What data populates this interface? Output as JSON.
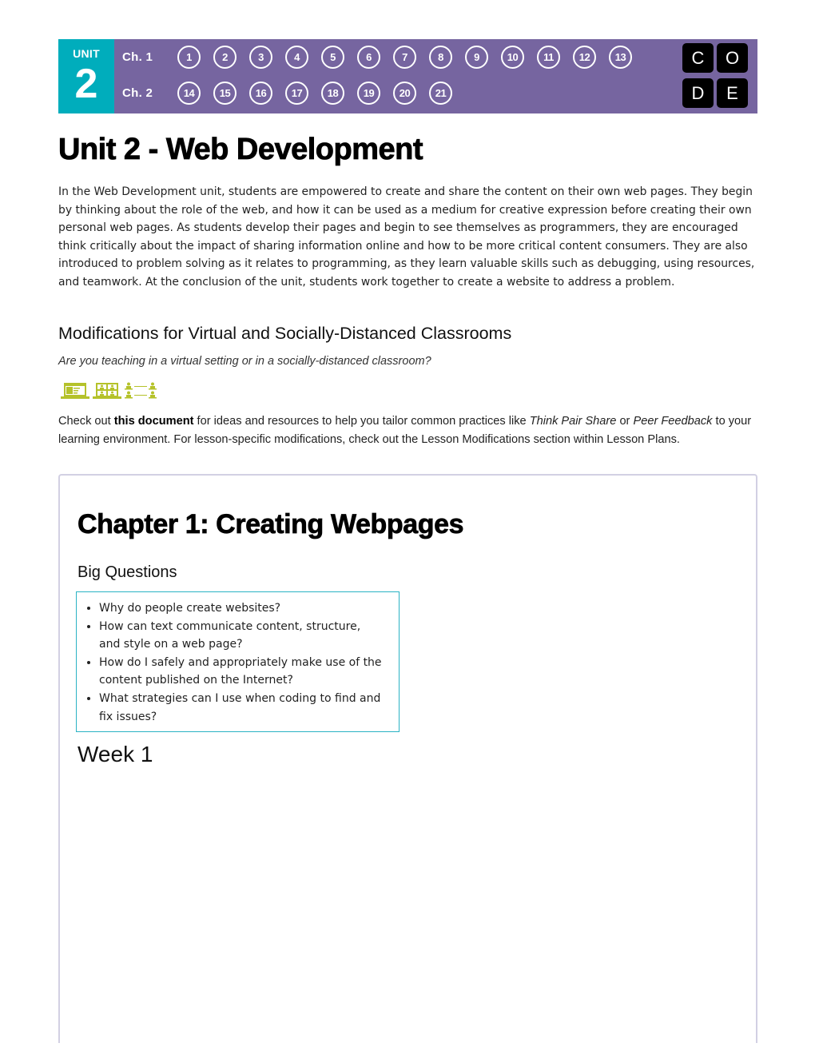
{
  "header": {
    "unit_label": "UNIT",
    "unit_number": "2",
    "chapters": [
      {
        "label": "Ch. 1",
        "lessons": [
          "1",
          "2",
          "3",
          "4",
          "5",
          "6",
          "7",
          "8",
          "9",
          "10",
          "11",
          "12",
          "13"
        ]
      },
      {
        "label": "Ch. 2",
        "lessons": [
          "14",
          "15",
          "16",
          "17",
          "18",
          "19",
          "20",
          "21"
        ]
      }
    ],
    "logo_letters": [
      "C",
      "O",
      "D",
      "E"
    ],
    "colors": {
      "unit_block": "#00adbc",
      "banner": "#7665a0",
      "logo_tile": "#000000"
    }
  },
  "page": {
    "title": "Unit 2 - Web Development",
    "intro": "In the Web Development unit, students are empowered to create and share the content on their own web pages. They begin by thinking about the role of the web, and how it can be used as a medium for creative expression before creating their own personal web pages. As students develop their pages and begin to see themselves as programmers, they are encouraged think critically about the impact of sharing information online and how to be more critical content consumers. They are also introduced to problem solving as it relates to programming, as they learn valuable skills such as debugging, using resources, and teamwork. At the conclusion of the unit, students work together to create a website to address a problem."
  },
  "modifications": {
    "title": "Modifications for Virtual and Socially-Distanced Classrooms",
    "question": "Are you teaching in a virtual setting or in a socially-distanced classroom?",
    "icons": [
      "laptop-document-icon",
      "video-call-icon",
      "social-distance-icon"
    ],
    "icon_color": "#b5c22a",
    "checkout_prefix": "Check out ",
    "checkout_link": "this document",
    "checkout_mid1": " for ideas and resources to help you tailor common practices like ",
    "practice1": "Think Pair Share",
    "checkout_or": " or ",
    "practice2": "Peer Feedback",
    "checkout_suffix": " to your learning environment. For lesson-specific modifications, check out the Lesson Modifications section within Lesson Plans."
  },
  "chapter": {
    "title": "Chapter 1: Creating Webpages",
    "big_questions_title": "Big Questions",
    "big_questions": [
      "Why do people create websites?",
      "How can text communicate content, structure, and style on a web page?",
      "How do I safely and appropriately make use of the content published on the Internet?",
      "What strategies can I use when coding to find and fix issues?"
    ],
    "week_title": "Week 1"
  }
}
